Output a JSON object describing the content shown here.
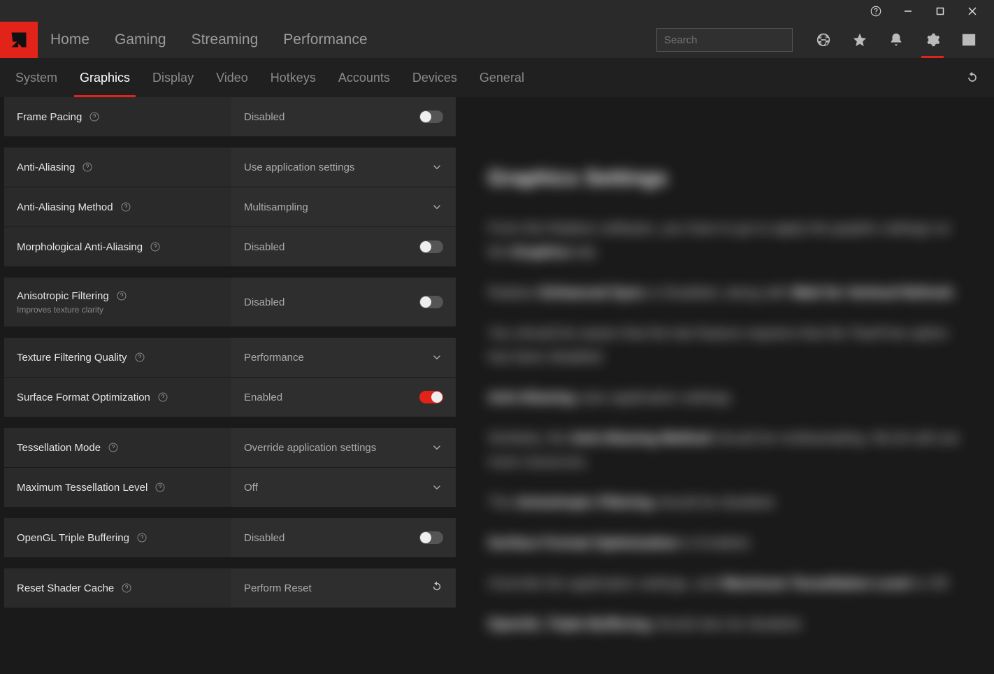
{
  "titlebar": {},
  "search": {
    "placeholder": "Search"
  },
  "mainnav": {
    "items": [
      "Home",
      "Gaming",
      "Streaming",
      "Performance"
    ]
  },
  "subnav": {
    "tabs": [
      "System",
      "Graphics",
      "Display",
      "Video",
      "Hotkeys",
      "Accounts",
      "Devices",
      "General"
    ],
    "active": 1
  },
  "settings": {
    "framePacing": {
      "label": "Frame Pacing",
      "value": "Disabled",
      "on": false
    },
    "antiAliasing": {
      "label": "Anti-Aliasing",
      "value": "Use application settings"
    },
    "aaMethod": {
      "label": "Anti-Aliasing Method",
      "value": "Multisampling"
    },
    "morphAA": {
      "label": "Morphological Anti-Aliasing",
      "value": "Disabled",
      "on": false
    },
    "anisotropic": {
      "label": "Anisotropic Filtering",
      "hint": "Improves texture clarity",
      "value": "Disabled",
      "on": false
    },
    "texFilterQuality": {
      "label": "Texture Filtering Quality",
      "value": "Performance"
    },
    "surfaceFormat": {
      "label": "Surface Format Optimization",
      "value": "Enabled",
      "on": true
    },
    "tessMode": {
      "label": "Tessellation Mode",
      "value": "Override application settings"
    },
    "maxTess": {
      "label": "Maximum Tessellation Level",
      "value": "Off"
    },
    "oglTriple": {
      "label": "OpenGL Triple Buffering",
      "value": "Disabled",
      "on": false
    },
    "resetShader": {
      "label": "Reset Shader Cache",
      "value": "Perform Reset"
    }
  },
  "right": {
    "title": "Graphics Settings",
    "p1a": "From the Radeon software, you have to go to apply the graphic settings on the ",
    "p1b": "Graphics",
    "p1c": " tab.",
    "p2a": "Radeon ",
    "p2b": "Enhanced Sync",
    "p2c": " is Disabled, along with ",
    "p2d": "Wait for Vertical Refresh",
    "p2e": ".",
    "p3": "You should be aware that the last feature requires that the TearFree option has been disabled.",
    "p4a": "Anti-Aliasing",
    "p4b": " uses application settings.",
    "p5a": "Similarly, the ",
    "p5b": "Anti-Aliasing Method",
    "p5c": " should be multisampling. MLAA will use more resources.",
    "p6a": "The ",
    "p6b": "Anisotropic Filtering",
    "p6c": " should be disabled.",
    "p7a": "Surface Format Optimization",
    "p7b": " is Enabled.",
    "p8a": "Override the application settings, and ",
    "p8b": "Maximum Tessellation Level",
    "p8c": " is Off.",
    "p9a": "OpenGL Triple Buffering",
    "p9b": " should also be disabled."
  }
}
